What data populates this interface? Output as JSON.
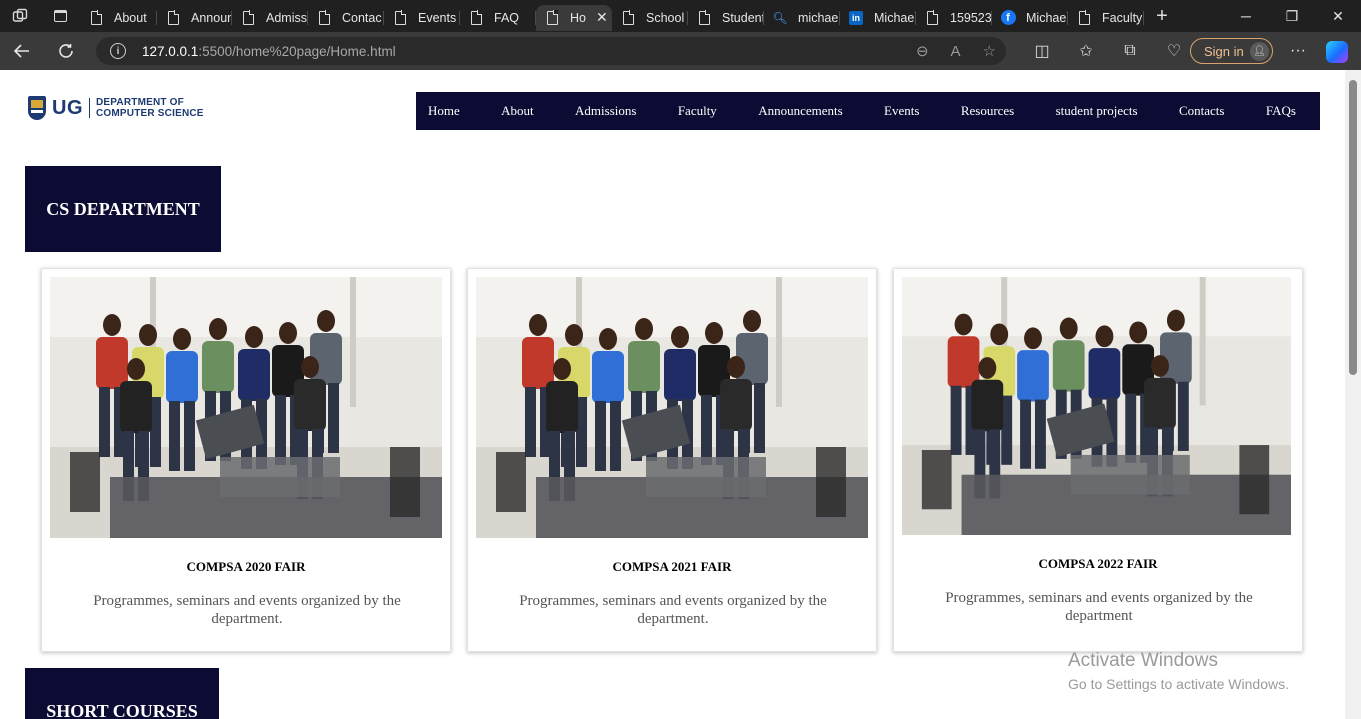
{
  "browser": {
    "tabs": [
      {
        "label": "About",
        "icon": "document-icon"
      },
      {
        "label": "Announ",
        "icon": "document-icon"
      },
      {
        "label": "Admiss",
        "icon": "document-icon"
      },
      {
        "label": "Contac",
        "icon": "document-icon"
      },
      {
        "label": "Events",
        "icon": "document-icon"
      },
      {
        "label": "FAQ",
        "icon": "document-icon"
      },
      {
        "label": "Ho",
        "icon": "document-icon",
        "active": true
      },
      {
        "label": "School",
        "icon": "document-icon"
      },
      {
        "label": "Student",
        "icon": "document-icon"
      },
      {
        "label": "michae",
        "icon": "search-icon"
      },
      {
        "label": "Michae",
        "icon": "linkedin-icon"
      },
      {
        "label": "159523",
        "icon": "document-icon"
      },
      {
        "label": "Michae",
        "icon": "facebook-icon"
      },
      {
        "label": "Faculty",
        "icon": "document-icon"
      }
    ],
    "url_host": "127.0.0.1",
    "url_rest": ":5500/home%20page/Home.html",
    "signin_label": "Sign in"
  },
  "site": {
    "logo_short": "UG",
    "logo_line1": "DEPARTMENT OF",
    "logo_line2": "COMPUTER SCIENCE",
    "nav": [
      "Home",
      "About",
      "Admissions",
      "Faculty",
      "Announcements",
      "Events",
      "Resources",
      "student projects",
      "Contacts",
      "FAQs"
    ],
    "section1_title": "CS DEPARTMENT",
    "section2_title": "SHORT COURSES",
    "cards": [
      {
        "title": "COMPSA 2020 FAIR",
        "text": "Programmes, seminars and events organized by the department."
      },
      {
        "title": "COMPSA 2021 FAIR",
        "text": "Programmes, seminars and events organized by the department."
      },
      {
        "title": "COMPSA 2022 FAIR",
        "text": "Programmes, seminars and events organized by the department"
      }
    ]
  },
  "os_watermark": {
    "line1": "Activate Windows",
    "line2": "Go to Settings to activate Windows."
  },
  "colors": {
    "nav_bg": "#0c0b33",
    "logo_blue": "#1d3a72",
    "chrome_dark": "#202020",
    "chrome_bar": "#3a3a3a"
  }
}
